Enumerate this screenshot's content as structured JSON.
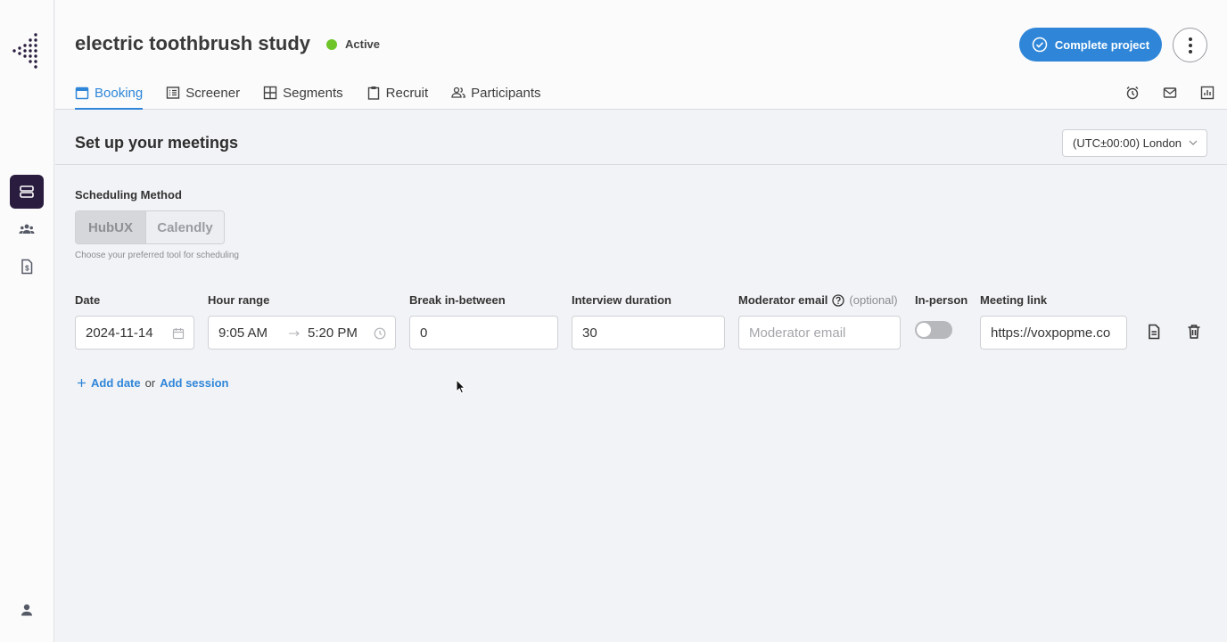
{
  "sidebar": {
    "icons": [
      "logo-icon",
      "server-icon",
      "people-icon",
      "invoice-icon",
      "user-icon"
    ]
  },
  "header": {
    "title": "electric toothbrush study",
    "status": "Active",
    "complete_label": "Complete project",
    "tabs": [
      {
        "label": "Booking",
        "icon": "calendar-icon",
        "active": true
      },
      {
        "label": "Screener",
        "icon": "list-icon"
      },
      {
        "label": "Segments",
        "icon": "grid-icon"
      },
      {
        "label": "Recruit",
        "icon": "clipboard-icon"
      },
      {
        "label": "Participants",
        "icon": "people-icon"
      }
    ],
    "right_icons": [
      "alarm-icon",
      "mail-icon",
      "chart-icon"
    ]
  },
  "section": {
    "title": "Set up your meetings",
    "timezone": "(UTC±00:00) London"
  },
  "scheduling": {
    "label": "Scheduling Method",
    "options": [
      "HubUX",
      "Calendly"
    ],
    "selected": "HubUX",
    "hint": "Choose your preferred tool for scheduling"
  },
  "columns": {
    "date": "Date",
    "hour_range": "Hour range",
    "break": "Break in-between",
    "duration": "Interview duration",
    "moderator": "Moderator email",
    "optional": "(optional)",
    "in_person": "In-person",
    "meeting_link": "Meeting link"
  },
  "row": {
    "date": "2024-11-14",
    "start": "9:05 AM",
    "end": "5:20 PM",
    "break": "0",
    "duration": "30",
    "moderator_placeholder": "Moderator email",
    "in_person": false,
    "meeting_link": "https://voxpopme.co"
  },
  "actions": {
    "add_date": "Add date",
    "or": "or",
    "add_session": "Add session"
  },
  "colors": {
    "accent": "#2f86d8",
    "active_status": "#6fc42a",
    "sidebar_active": "#2a1c3e"
  }
}
